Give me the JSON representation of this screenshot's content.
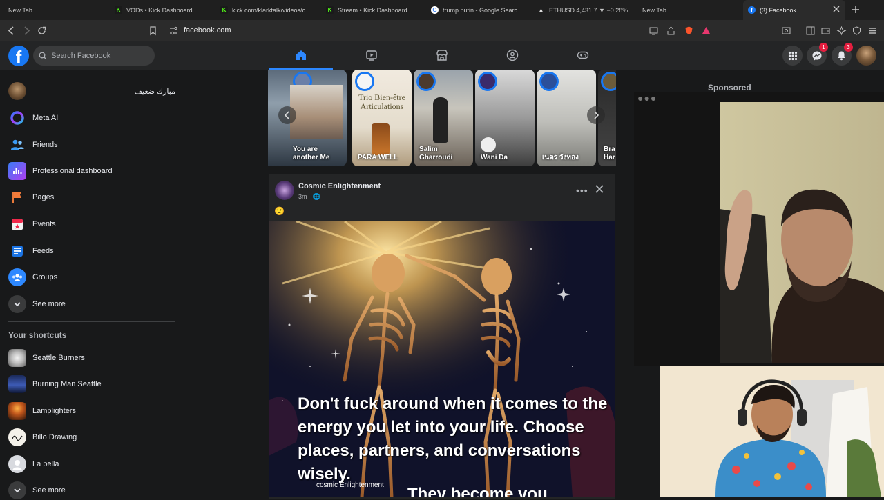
{
  "browser": {
    "tabs": [
      {
        "title": "New Tab",
        "favicon": "none"
      },
      {
        "title": "VODs • Kick Dashboard",
        "favicon": "kick-icon"
      },
      {
        "title": "kick.com/klarktalk/videos/c",
        "favicon": "kick-icon"
      },
      {
        "title": "Stream • Kick Dashboard",
        "favicon": "kick-icon"
      },
      {
        "title": "trump putin - Google Searc",
        "favicon": "google-icon"
      },
      {
        "title": "ETHUSD 4,431.7 ▼ −0.28%",
        "favicon": "tradingview-icon"
      },
      {
        "title": "New Tab",
        "favicon": "none"
      },
      {
        "title": "(3) Facebook",
        "favicon": "facebook-icon",
        "active": true
      }
    ],
    "url": "facebook.com"
  },
  "facebook": {
    "search_placeholder": "Search Facebook",
    "messenger_badge": "1",
    "notifications_badge": "3",
    "accent": "#1877f2"
  },
  "sidebar": {
    "profile_name": "مبارك ضعيف",
    "items": [
      {
        "label": "Meta AI",
        "icon": "meta-ai-icon"
      },
      {
        "label": "Friends",
        "icon": "friends-icon"
      },
      {
        "label": "Professional dashboard",
        "icon": "dashboard-icon"
      },
      {
        "label": "Pages",
        "icon": "pages-flag-icon"
      },
      {
        "label": "Events",
        "icon": "events-calendar-icon"
      },
      {
        "label": "Feeds",
        "icon": "feeds-icon"
      },
      {
        "label": "Groups",
        "icon": "groups-icon"
      },
      {
        "label": "See more",
        "icon": "chevron-down-icon"
      }
    ],
    "shortcuts_title": "Your shortcuts",
    "shortcuts": [
      {
        "label": "Seattle Burners"
      },
      {
        "label": "Burning Man Seattle"
      },
      {
        "label": "Lamplighters"
      },
      {
        "label": "Billo Drawing"
      },
      {
        "label": "La pella"
      },
      {
        "label": "See more"
      }
    ]
  },
  "stories": [
    {
      "name": "You are another Me"
    },
    {
      "name": "PARA WELL",
      "overlay_title": "Trio Bien-être Articulations"
    },
    {
      "name": "Salim Gharroudi"
    },
    {
      "name": "Wani Da"
    },
    {
      "name": "เนตร วังทอง"
    },
    {
      "name": "Bra Har"
    }
  ],
  "post": {
    "author": "Cosmic Enlightenment",
    "time": "3m",
    "emoji": "🙂",
    "image_text": "Don't fuck around when it comes to the energy you let into your life. Choose places, partners, and conversations wisely.",
    "image_text_cutoff": "They become you",
    "image_signature": "cosmic Enlightenment"
  },
  "right": {
    "sponsored": "Sponsored"
  }
}
